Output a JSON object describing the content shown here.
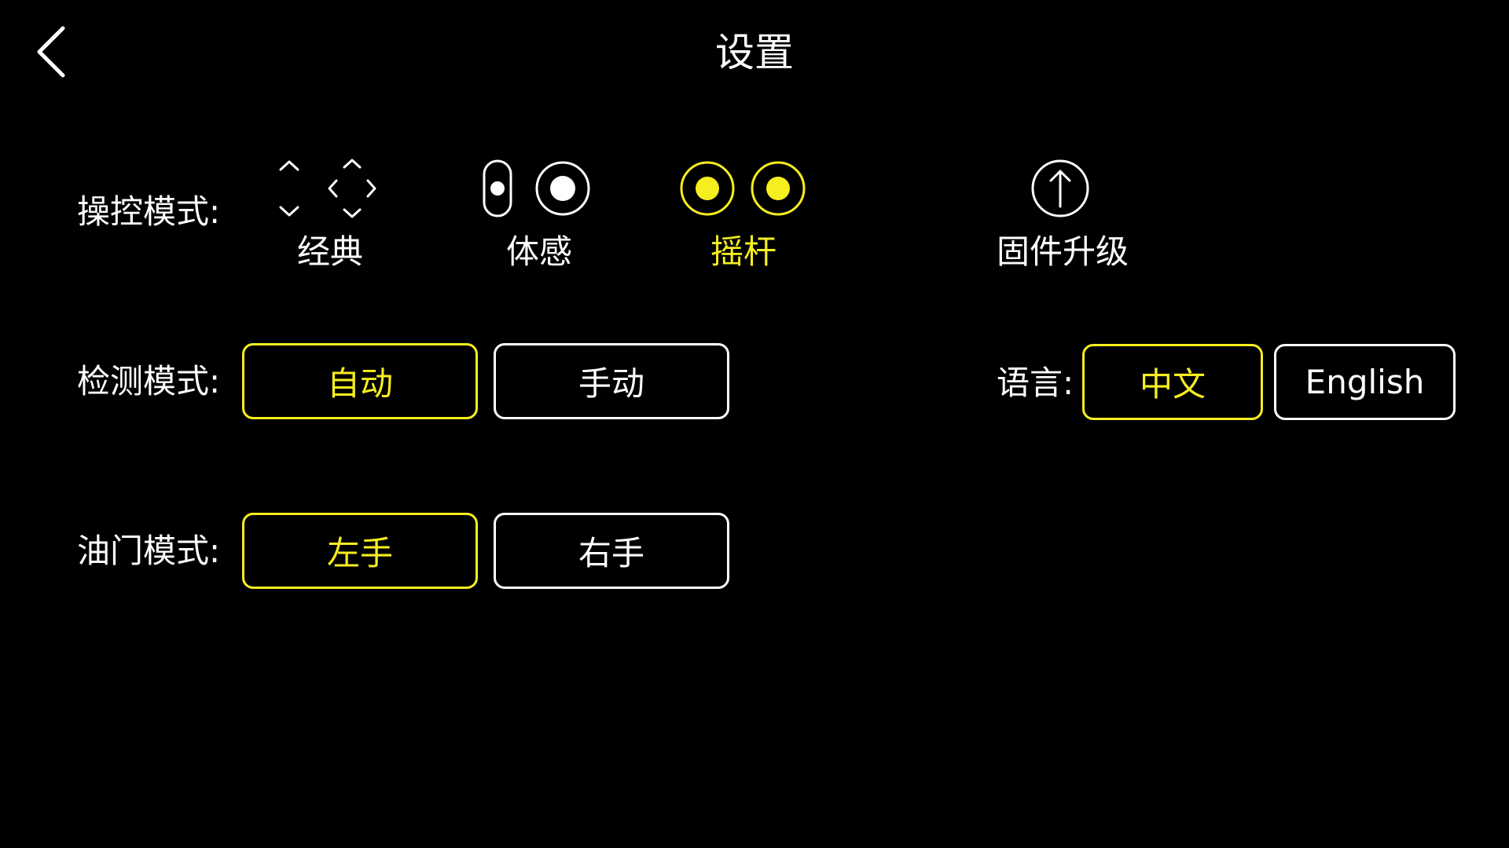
{
  "title": "设置",
  "colors": {
    "background": "#000000",
    "text": "#ffffff",
    "accent": "#f6ee1f"
  },
  "control_mode": {
    "label": "操控模式:",
    "options": [
      {
        "label": "经典",
        "icon": "dpad-icon",
        "selected": false
      },
      {
        "label": "体感",
        "icon": "motion-sense-icon",
        "selected": false
      },
      {
        "label": "摇杆",
        "icon": "joystick-icon",
        "selected": true
      }
    ]
  },
  "firmware": {
    "label": "固件升级",
    "icon": "upload-arrow-icon"
  },
  "detect_mode": {
    "label": "检测模式:",
    "options": [
      {
        "label": "自动",
        "selected": true
      },
      {
        "label": "手动",
        "selected": false
      }
    ]
  },
  "language": {
    "label": "语言:",
    "options": [
      {
        "label": "中文",
        "selected": true
      },
      {
        "label": "English",
        "selected": false
      }
    ]
  },
  "throttle_mode": {
    "label": "油门模式:",
    "options": [
      {
        "label": "左手",
        "selected": true
      },
      {
        "label": "右手",
        "selected": false
      }
    ]
  }
}
